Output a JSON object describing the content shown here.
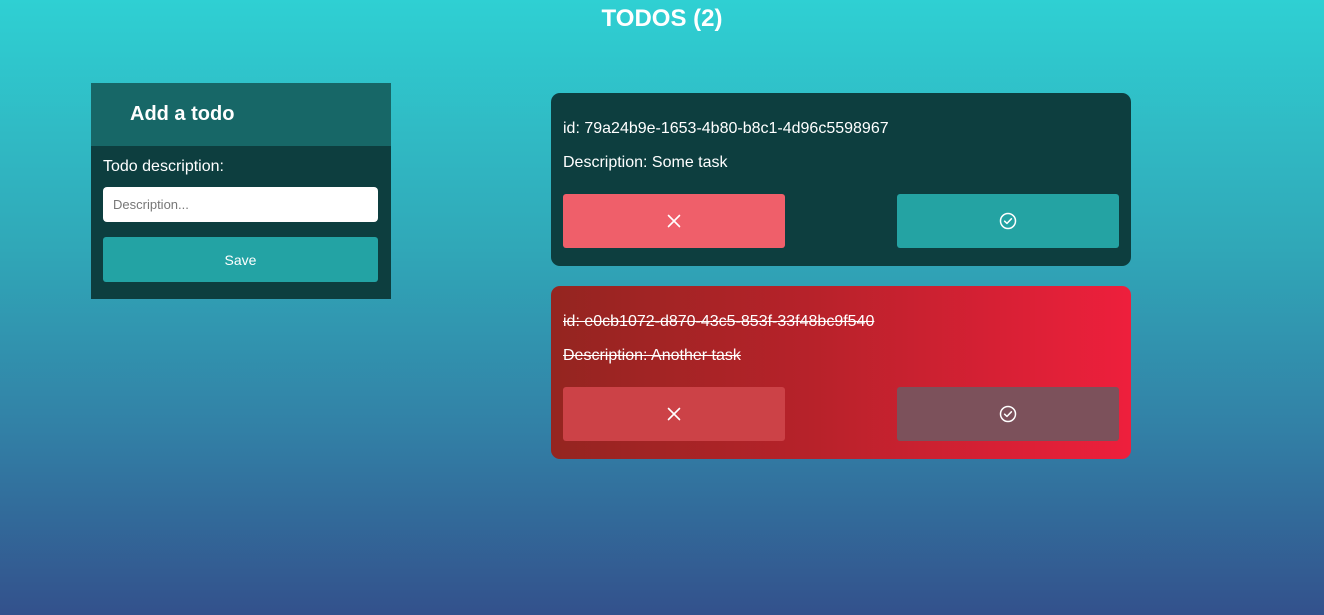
{
  "header": {
    "title": "TODOS (2)"
  },
  "add_form": {
    "heading": "Add a todo",
    "label": "Todo description:",
    "input_value": "",
    "input_placeholder": "Description...",
    "save_label": "Save"
  },
  "todos": [
    {
      "id_text": "id: 79a24b9e-1653-4b80-b8c1-4d96c5598967",
      "description_text": "Description: Some task",
      "completed": false,
      "delete_icon": "x-icon",
      "complete_icon": "check-circle-icon"
    },
    {
      "id_text": "id: e0cb1072-d870-43c5-853f-33f48bc9f540",
      "description_text": "Description: Another task",
      "completed": true,
      "delete_icon": "x-icon",
      "complete_icon": "check-circle-icon"
    }
  ],
  "colors": {
    "panel_dark": "#0d3e3f",
    "panel_header": "#176767",
    "teal_button": "#23a3a4",
    "delete_button": "#ef5f6a",
    "completed_card_gradient_start": "#942520",
    "completed_card_gradient_end": "#ee1f3c"
  }
}
